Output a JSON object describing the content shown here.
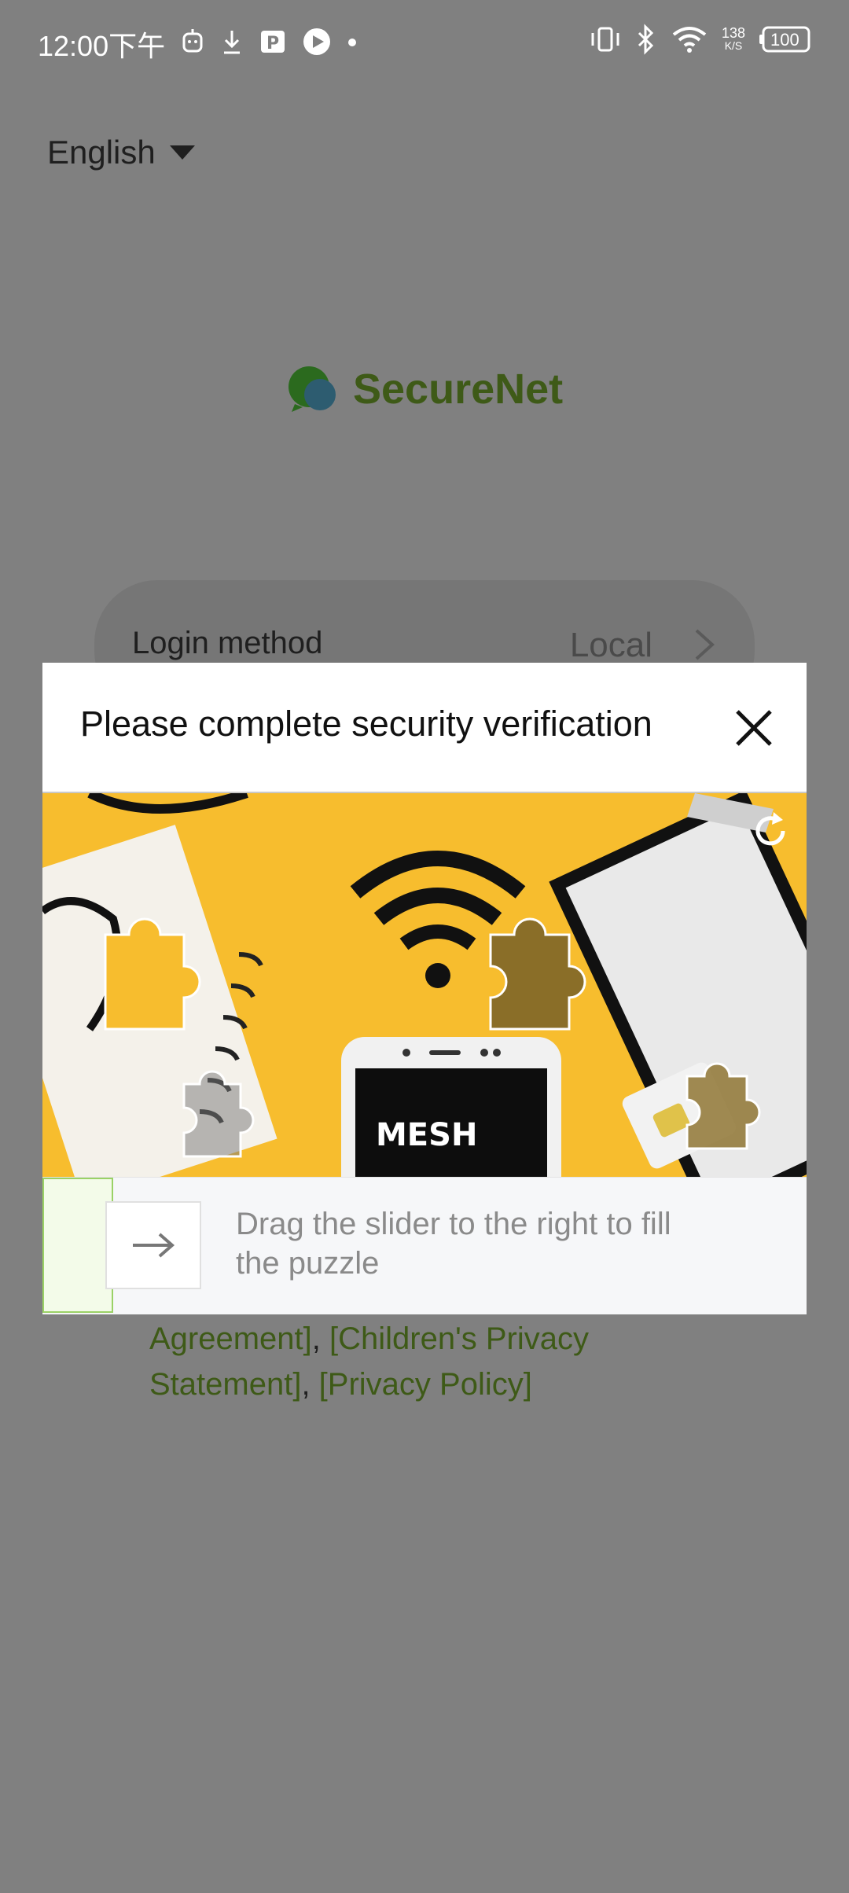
{
  "status_bar": {
    "time": "12:00下午",
    "net_speed_value": "138",
    "net_speed_unit": "K/S",
    "battery": "100"
  },
  "language": {
    "label": "English"
  },
  "brand": {
    "name": "SecureNet",
    "logo_icon": "chat-bubbles-icon"
  },
  "login": {
    "label": "Login method",
    "value": "Local"
  },
  "agreement": {
    "link1": "Agreement]",
    "sep1": ", ",
    "link2": "[Children's Privacy Statement]",
    "sep2": ", ",
    "link3": "[Privacy Policy]"
  },
  "modal": {
    "title": "Please complete security verification",
    "close_icon": "close-icon",
    "refresh_icon": "refresh-icon",
    "image_text": "MESH",
    "slider_hint": "Drag the slider to the right to fill the puzzle",
    "slider_progress": 0
  },
  "colors": {
    "scrim": "#808080",
    "brand_green": "#3e5a17",
    "puzzle_bg": "#f7bd2e",
    "slider_border": "#9ad166"
  }
}
